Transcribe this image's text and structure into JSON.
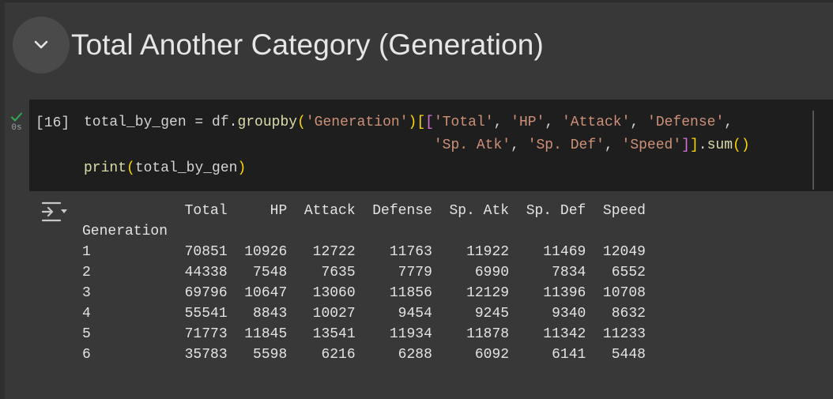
{
  "section": {
    "title": "Total Another Category (Generation)",
    "collapse_icon": "chevron-down-icon"
  },
  "cell": {
    "exec_count": "[16]",
    "status_icon": "check-icon",
    "exec_time": "0s",
    "code_lines": [
      "total_by_gen = df.groupby('Generation')[['Total', 'HP', 'Attack', 'Defense',",
      "                                         'Sp. Atk', 'Sp. Def', 'Speed']].sum()",
      "print(total_by_gen)"
    ]
  },
  "output": {
    "icon": "output-options-icon",
    "lines": [
      "            Total     HP  Attack  Defense  Sp. Atk  Sp. Def  Speed",
      "Generation",
      "1           70851  10926   12722    11763    11922    11469  12049",
      "2           44338   7548    7635     7779     6990     7834   6552",
      "3           69796  10647   13060    11856    12129    11396  10708",
      "4           55541   8843   10027     9454     9245     9340   8632",
      "5           71773  11845   13541    11934    11878    11342  11233",
      "6           35783   5598    6216     6288     6092     6141   5448"
    ]
  },
  "colors": {
    "background": "#383838",
    "code_background": "#1e1e1e",
    "success_check": "#34a853",
    "string": "#ce9178",
    "function": "#dcdcaa"
  }
}
